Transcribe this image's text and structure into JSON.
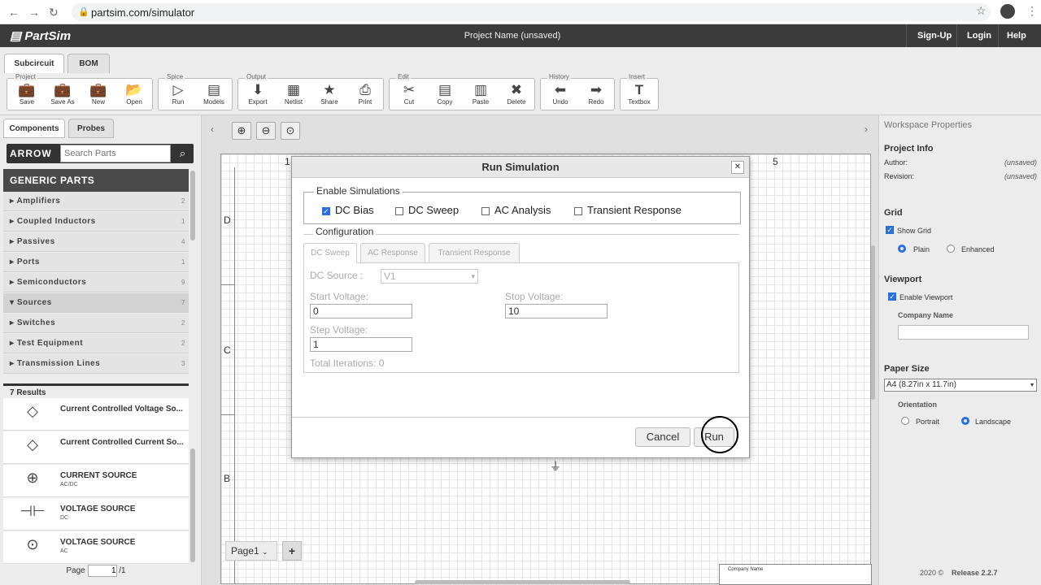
{
  "browser": {
    "url": "partsim.com/simulator"
  },
  "app": {
    "logo": "PartSim",
    "project_name": "Project Name (unsaved)",
    "links": [
      "Sign-Up",
      "Login",
      "Help"
    ]
  },
  "tabs": [
    "Subcircuit",
    "BOM"
  ],
  "toolbar": {
    "groups": {
      "project": "Project",
      "spice": "Spice",
      "output": "Output",
      "edit": "Edit",
      "history": "History",
      "insert": "Insert"
    },
    "buttons": [
      "Save",
      "Save As",
      "New",
      "Open",
      "Run",
      "Models",
      "Export",
      "Netlist",
      "Share",
      "Print",
      "Cut",
      "Copy",
      "Paste",
      "Delete",
      "Undo",
      "Redo",
      "Textbox"
    ]
  },
  "leftpanel": {
    "tabs": [
      "Components",
      "Probes"
    ],
    "brand": "ARROW",
    "search_placeholder": "Search Parts",
    "section": "GENERIC PARTS",
    "categories": [
      {
        "name": "Amplifiers",
        "count": "2"
      },
      {
        "name": "Coupled Inductors",
        "count": "1"
      },
      {
        "name": "Passives",
        "count": "4"
      },
      {
        "name": "Ports",
        "count": "1"
      },
      {
        "name": "Semiconductors",
        "count": "9"
      },
      {
        "name": "Sources",
        "count": "7"
      },
      {
        "name": "Switches",
        "count": "2"
      },
      {
        "name": "Test Equipment",
        "count": "2"
      },
      {
        "name": "Transmission Lines",
        "count": "3"
      }
    ],
    "results_label": "7 Results",
    "results": [
      {
        "title": "Current Controlled Voltage So...",
        "sub": ""
      },
      {
        "title": "Current Controlled Current So...",
        "sub": ""
      },
      {
        "title": "CURRENT SOURCE",
        "sub": "AC/DC"
      },
      {
        "title": "VOLTAGE SOURCE",
        "sub": "DC"
      },
      {
        "title": "VOLTAGE SOURCE",
        "sub": "AC"
      }
    ],
    "pager": {
      "label": "Page",
      "value": "1",
      "total": "/1"
    }
  },
  "canvas": {
    "page_tab": "Page1",
    "add": "+",
    "row_labels": [
      "D",
      "C",
      "B"
    ],
    "col_labels": [
      "1",
      "5"
    ],
    "title_block": "Company Name"
  },
  "rightpanel": {
    "title": "Workspace Properties",
    "project_info": "Project Info",
    "author_label": "Author:",
    "author_value": "(unsaved)",
    "revision_label": "Revision:",
    "revision_value": "(unsaved)",
    "grid": "Grid",
    "show_grid": "Show Grid",
    "plain": "Plain",
    "enhanced": "Enhanced",
    "viewport": "Viewport",
    "enable_viewport": "Enable Viewport",
    "company_name": "Company Name",
    "paper_size": "Paper Size",
    "paper_value": "A4 (8.27in x 11.7in)",
    "orientation": "Orientation",
    "portrait": "Portrait",
    "landscape": "Landscape",
    "footer_year": "2020 ©",
    "footer_release": "Release 2.2.7"
  },
  "modal": {
    "title": "Run Simulation",
    "enable_legend": "Enable Simulations",
    "sims": [
      {
        "label": "DC Bias",
        "checked": true
      },
      {
        "label": "DC Sweep",
        "checked": false
      },
      {
        "label": "AC Analysis",
        "checked": false
      },
      {
        "label": "Transient Response",
        "checked": false
      }
    ],
    "config_legend": "Configuration",
    "subtabs": [
      "DC Sweep",
      "AC Response",
      "Transient Response"
    ],
    "dc_source_label": "DC Source :",
    "dc_source_value": "V1",
    "start_label": "Start Voltage:",
    "start_value": "0",
    "stop_label": "Stop Voltage:",
    "stop_value": "10",
    "step_label": "Step Voltage:",
    "step_value": "1",
    "total_label": "Total Iterations: 0",
    "cancel": "Cancel",
    "run": "Run"
  }
}
